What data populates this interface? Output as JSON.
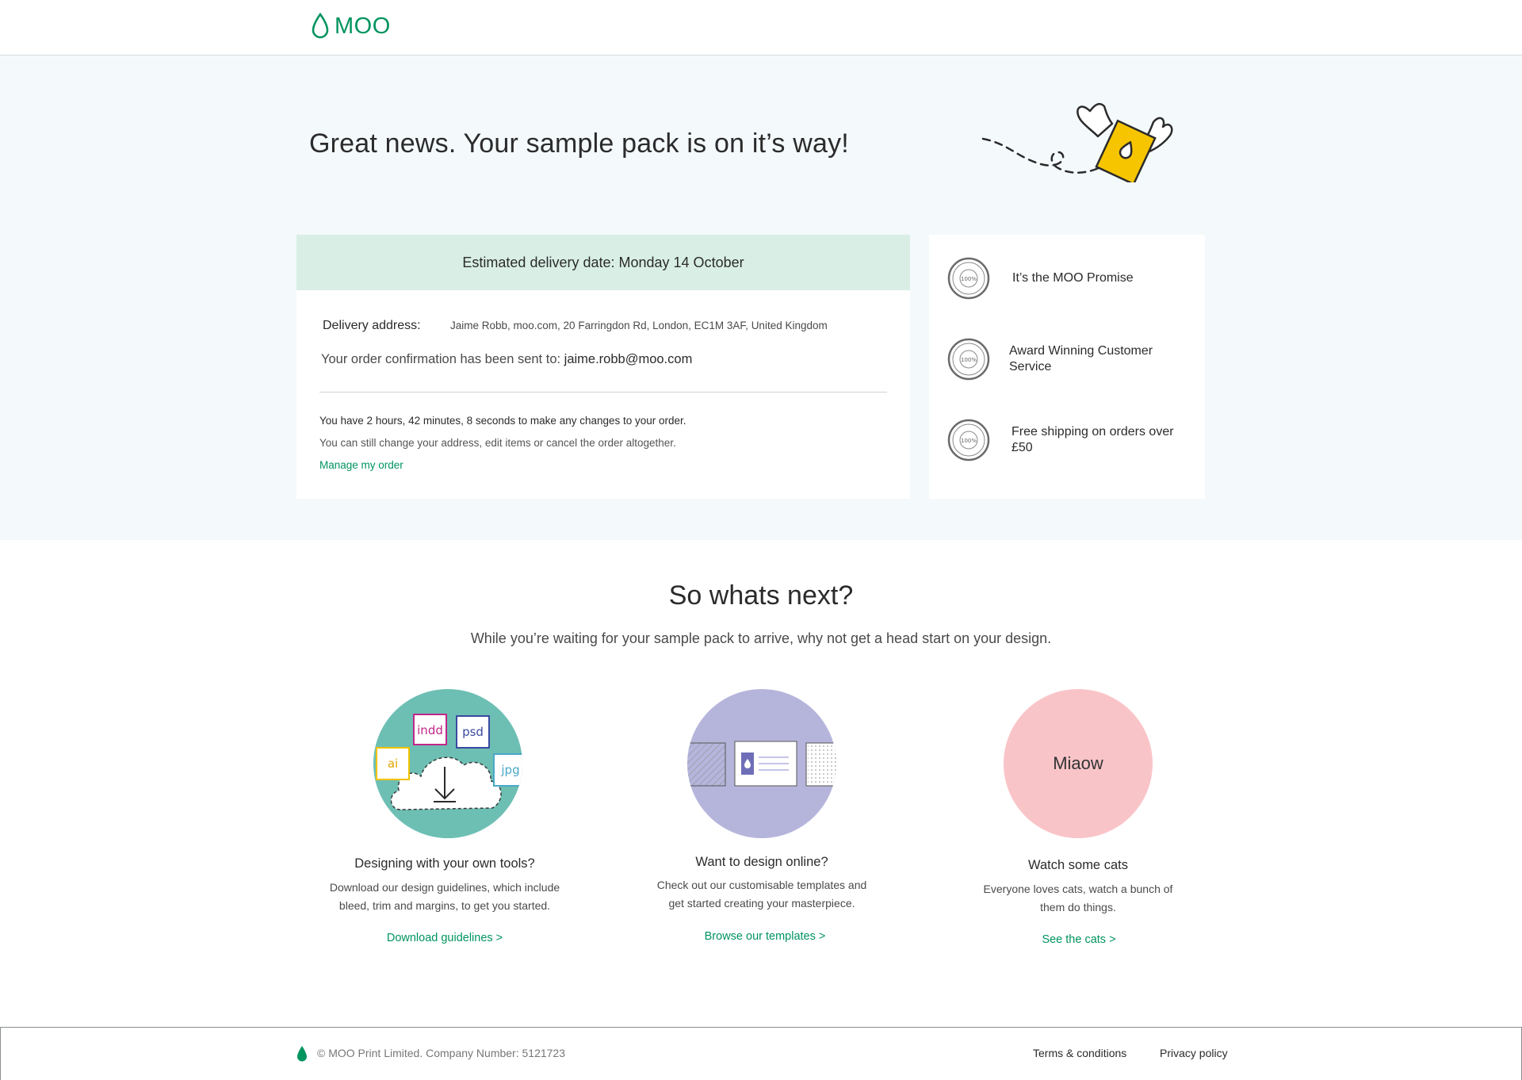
{
  "header": {
    "logo_text": "MOO"
  },
  "hero": {
    "title": "Great news. Your sample pack is on it’s way!",
    "delivery_bar": "Estimated delivery date: Monday 14 October",
    "address_label": "Delivery address:",
    "address_value": "Jaime Robb, moo.com, 20 Farringdon Rd, London, EC1M 3AF, United Kingdom",
    "confirm_text": "Your order confirmation has been sent to: ",
    "confirm_email": "jaime.robb@moo.com",
    "timer_text": "You have 2 hours, 42 minutes, 8 seconds to make any changes to your order.",
    "note_text": "You can still change your address, edit items or cancel the order altogether.",
    "manage_link": "Manage my order"
  },
  "promises": [
    {
      "text": "It’s the MOO Promise"
    },
    {
      "text": "Award Winning Customer Service"
    },
    {
      "text": "Free shipping on orders over £50"
    }
  ],
  "seal_text": {
    "top": "SATISFACTION",
    "center": "100%",
    "bottom": "GUARANTEED"
  },
  "next": {
    "title": "So whats next?",
    "subtitle": "While you’re waiting for your sample pack to arrive, why not get a head start on your design.",
    "columns": [
      {
        "title": "Designing with your own tools?",
        "desc_line1": "Download our design guidelines, which include",
        "desc_line2": "bleed, trim and margins, to get you started.",
        "link": "Download guidelines >",
        "file_tags": [
          "indd",
          "psd",
          "ai",
          "jpg"
        ],
        "circle_color": "#6dbfb4"
      },
      {
        "title": "Want to design online?",
        "desc_line1": "Check out our customisable templates and",
        "desc_line2": "get started creating your masterpiece.",
        "link": "Browse our templates >",
        "circle_color": "#b5b5dc"
      },
      {
        "title": "Watch some cats",
        "desc_line1": "Everyone loves cats, watch a bunch of",
        "desc_line2": "them do things.",
        "link": "See the cats >",
        "circle_label": "Miaow",
        "circle_color": "#f9c4c8"
      }
    ]
  },
  "footer": {
    "copyright": "© MOO Print Limited. Company Number: 5121723",
    "terms": "Terms & conditions",
    "privacy": "Privacy policy"
  },
  "colors": {
    "brand_green": "#00945f",
    "hero_bg": "#f4f9fb",
    "delivery_bar_bg": "#d9efe6",
    "card_yellow": "#f7c500"
  }
}
